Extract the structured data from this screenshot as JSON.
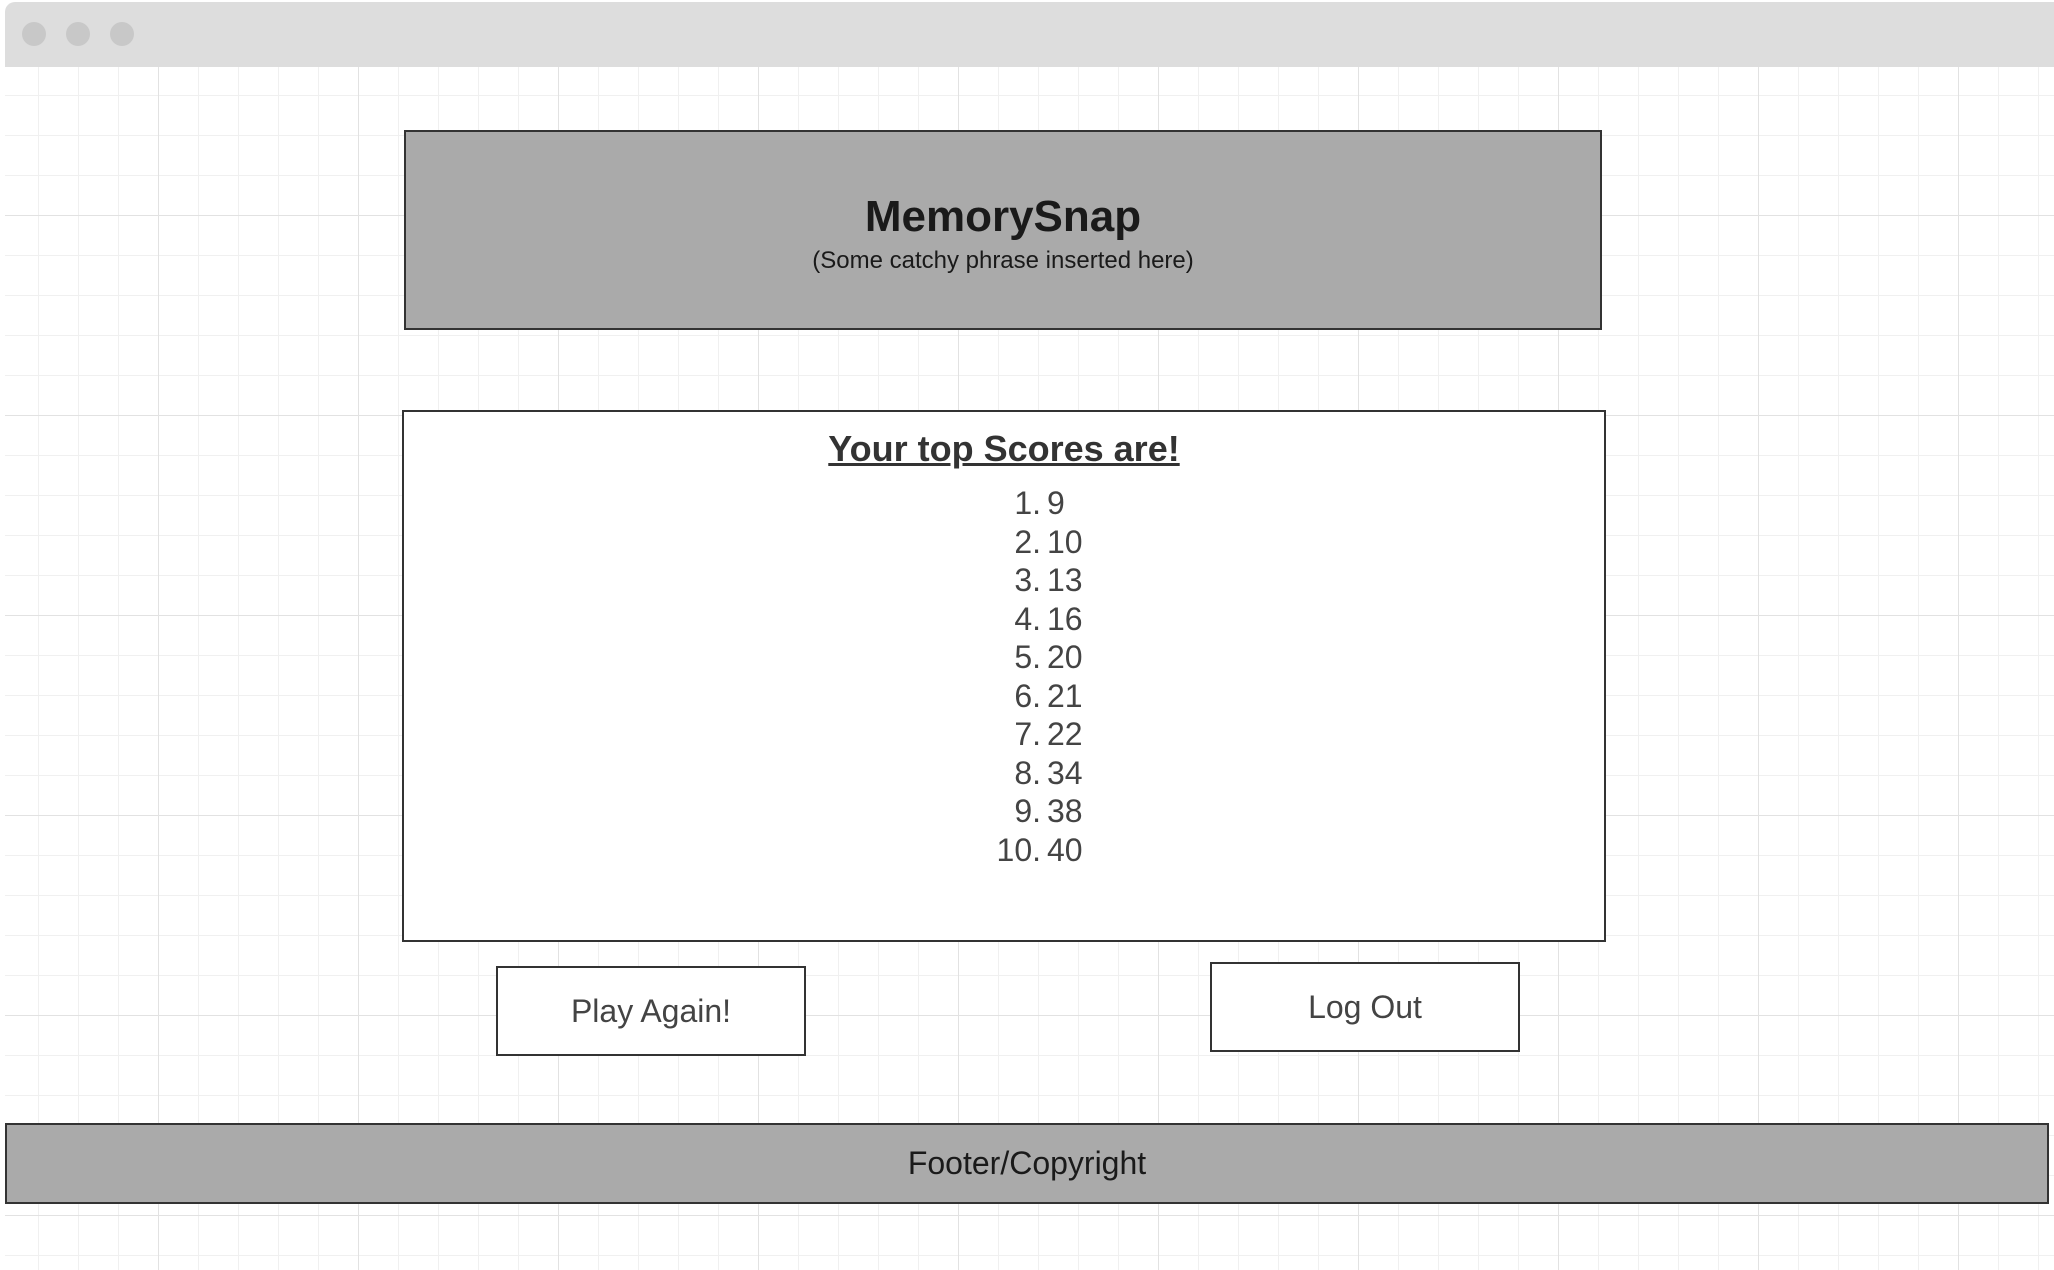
{
  "header": {
    "title": "MemorySnap",
    "subtitle": "(Some catchy phrase inserted here)"
  },
  "scores": {
    "heading": "Your top Scores are!",
    "items": [
      {
        "rank": "1.",
        "value": "9"
      },
      {
        "rank": "2.",
        "value": "10"
      },
      {
        "rank": "3.",
        "value": "13"
      },
      {
        "rank": "4.",
        "value": "16"
      },
      {
        "rank": "5.",
        "value": "20"
      },
      {
        "rank": "6.",
        "value": "21"
      },
      {
        "rank": "7.",
        "value": "22"
      },
      {
        "rank": "8.",
        "value": "34"
      },
      {
        "rank": "9.",
        "value": "38"
      },
      {
        "rank": "10.",
        "value": "40"
      }
    ]
  },
  "actions": {
    "play_again_label": "Play Again!",
    "log_out_label": "Log Out"
  },
  "footer": {
    "text": "Footer/Copyright"
  },
  "colors": {
    "titlebar": "#dddddd",
    "header_bg": "#aaaaaa",
    "footer_bg": "#aaaaaa",
    "border": "#333333"
  }
}
